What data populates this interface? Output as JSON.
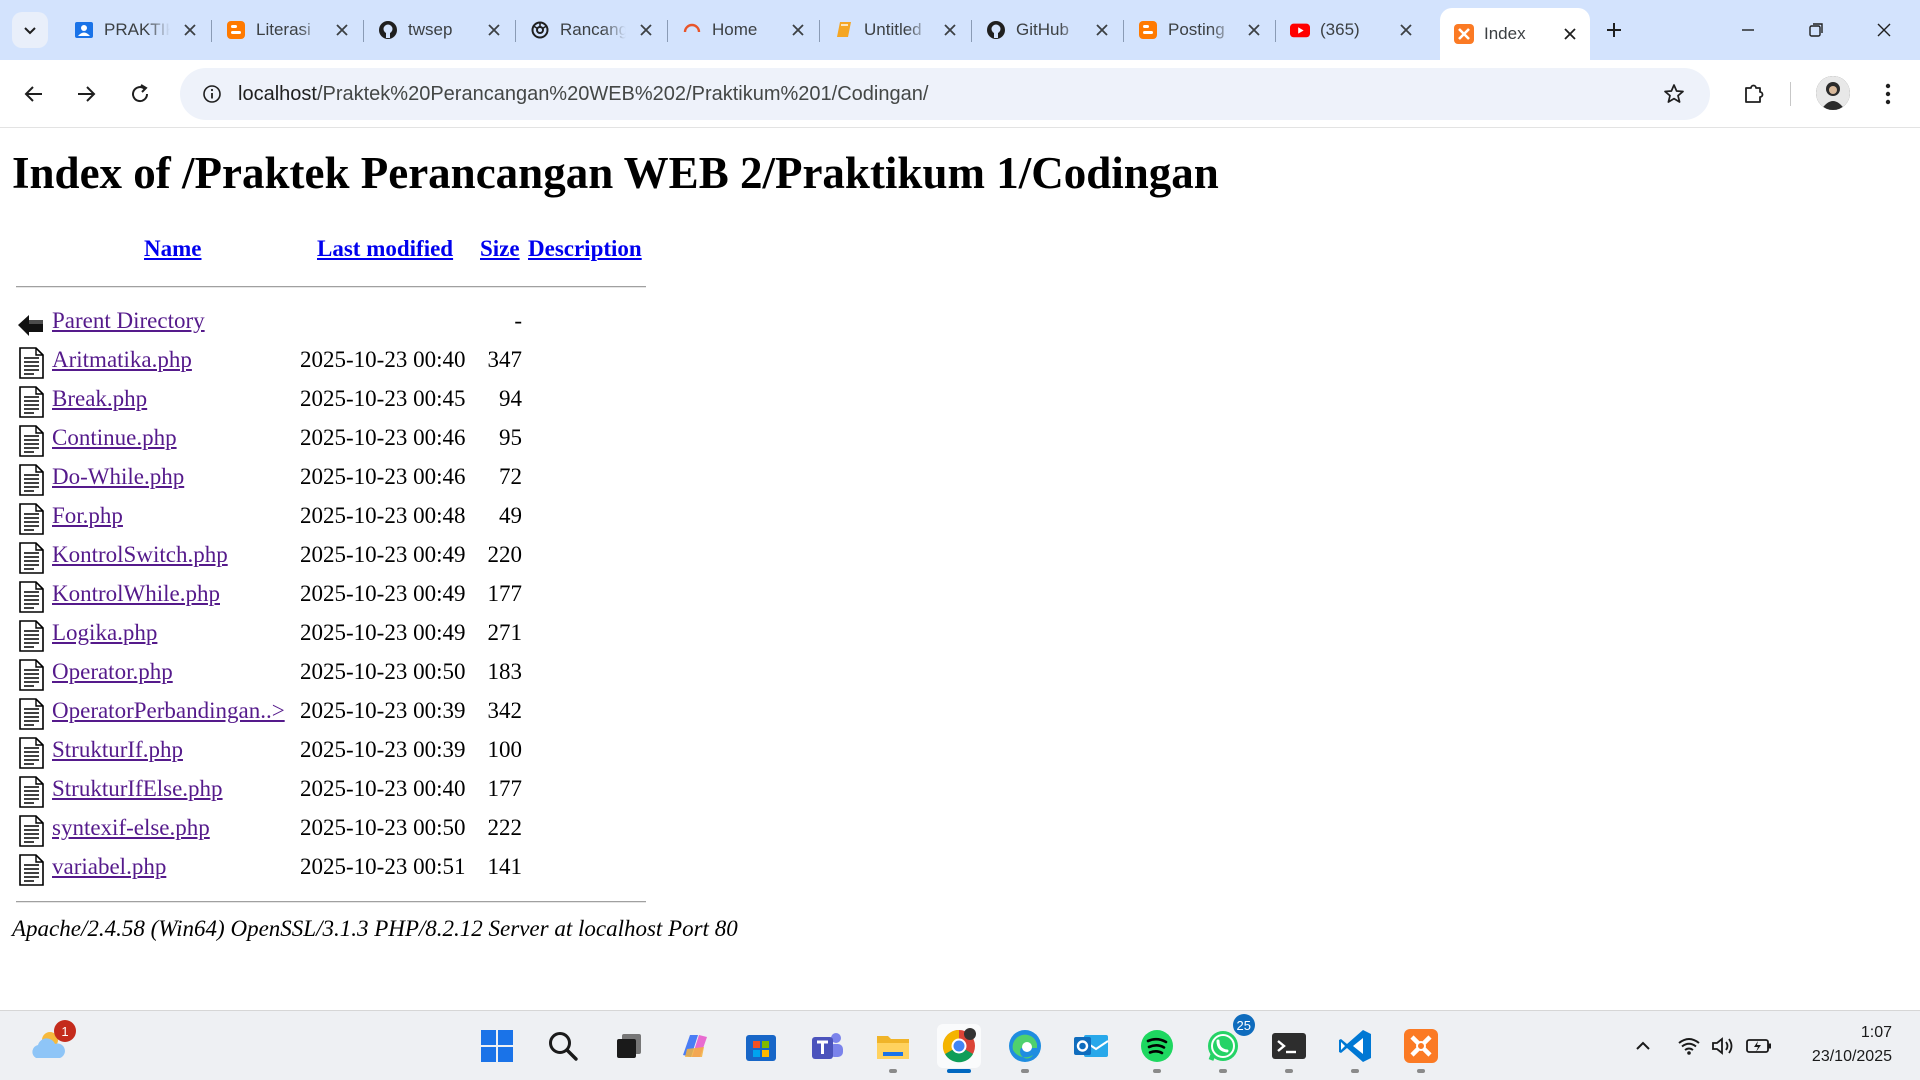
{
  "tabs": [
    {
      "title": "PRAKTIKUM",
      "favicon": "contacts-icon",
      "active": false
    },
    {
      "title": "Literasi",
      "favicon": "blogger-icon",
      "active": false
    },
    {
      "title": "twsep",
      "favicon": "github-icon",
      "active": false
    },
    {
      "title": "Rancangan",
      "favicon": "openai-icon",
      "active": false
    },
    {
      "title": "Home",
      "favicon": "loading-spinner-icon",
      "active": false
    },
    {
      "title": "Untitled",
      "favicon": "book-icon",
      "active": false
    },
    {
      "title": "GitHub",
      "favicon": "github-icon",
      "active": false
    },
    {
      "title": "Posting",
      "favicon": "blogger-icon",
      "active": false
    },
    {
      "title": "(365)",
      "favicon": "youtube-icon",
      "active": false
    },
    {
      "title": "Index",
      "favicon": "xampp-icon",
      "active": true
    }
  ],
  "address_bar": {
    "host": "localhost",
    "path": "/Praktek%20Perancangan%20WEB%202/Praktikum%201/Codingan/"
  },
  "page": {
    "title": "Index of /Praktek Perancangan WEB 2/Praktikum 1/Codingan",
    "columns": {
      "name": "Name",
      "last_modified": "Last modified",
      "size": "Size",
      "description": "Description"
    },
    "parent": {
      "name": "Parent Directory",
      "size": "-"
    },
    "files": [
      {
        "name": "Aritmatika.php",
        "modified": "2025-10-23 00:40",
        "size": "347"
      },
      {
        "name": "Break.php",
        "modified": "2025-10-23 00:45",
        "size": "94"
      },
      {
        "name": "Continue.php",
        "modified": "2025-10-23 00:46",
        "size": "95"
      },
      {
        "name": "Do-While.php",
        "modified": "2025-10-23 00:46",
        "size": "72"
      },
      {
        "name": "For.php",
        "modified": "2025-10-23 00:48",
        "size": "49"
      },
      {
        "name": "KontrolSwitch.php",
        "modified": "2025-10-23 00:49",
        "size": "220"
      },
      {
        "name": "KontrolWhile.php",
        "modified": "2025-10-23 00:49",
        "size": "177"
      },
      {
        "name": "Logika.php",
        "modified": "2025-10-23 00:49",
        "size": "271"
      },
      {
        "name": "Operator.php",
        "modified": "2025-10-23 00:50",
        "size": "183"
      },
      {
        "name": "OperatorPerbandingan..>",
        "modified": "2025-10-23 00:39",
        "size": "342"
      },
      {
        "name": "StrukturIf.php",
        "modified": "2025-10-23 00:39",
        "size": "100"
      },
      {
        "name": "StrukturIfElse.php",
        "modified": "2025-10-23 00:40",
        "size": "177"
      },
      {
        "name": "syntexif-else.php",
        "modified": "2025-10-23 00:50",
        "size": "222"
      },
      {
        "name": "variabel.php",
        "modified": "2025-10-23 00:51",
        "size": "141"
      }
    ],
    "footer": "Apache/2.4.58 (Win64) OpenSSL/3.1.3 PHP/8.2.12 Server at localhost Port 80"
  },
  "taskbar": {
    "weather_badge": "1",
    "whatsapp_badge": "25",
    "apps": [
      "start-icon",
      "search-icon",
      "task-view-icon",
      "copilot-icon",
      "store-icon",
      "teams-icon",
      "file-explorer-icon",
      "chrome-icon",
      "edge-icon",
      "outlook-icon",
      "spotify-icon",
      "whatsapp-icon",
      "terminal-icon",
      "vscode-icon",
      "xampp-icon"
    ],
    "time": "1:07",
    "date": "23/10/2025"
  },
  "colors": {
    "tabstrip": "#d3e3fd",
    "link": "#551a8b",
    "header_link": "#0000ee",
    "taskbar": "#eef0f3"
  }
}
